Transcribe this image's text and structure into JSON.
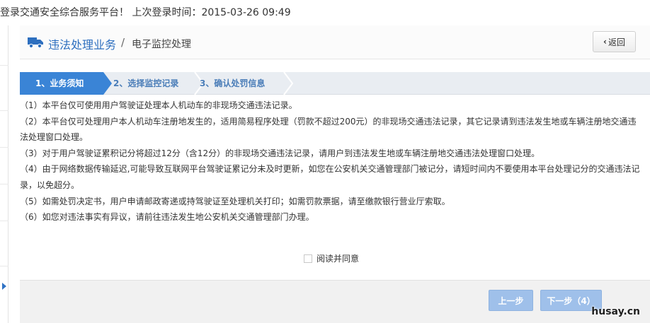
{
  "topbar": {
    "welcome": "登录交通安全综合服务平台！ 上次登录时间：2015-03-26 09:49"
  },
  "header": {
    "title": "违法处理业务",
    "separator": "/",
    "subtitle": "电子监控处理",
    "back_label": "返回"
  },
  "steps": [
    {
      "label": "1、业务须知",
      "state": "active"
    },
    {
      "label": "2、选择监控记录",
      "state": "pending"
    },
    {
      "label": "3、确认处罚信息",
      "state": "pending"
    }
  ],
  "notices": [
    "（1）本平台仅可使用用户驾驶证处理本人机动车的非现场交通违法记录。",
    "（2）本平台仅可处理用户本人机动车注册地发生的，适用简易程序处理（罚款不超过200元）的非现场交通违法记录，其它记录请到违法发生地或车辆注册地交通违",
    "法处理窗口处理。",
    "（3）对于用户驾驶证累积记分将超过12分（含12分）的非现场交通违法记录，请用户到违法发生地或车辆注册地交通违法处理窗口处理。",
    "（4）由于网络数据传输延迟,可能导致互联网平台驾驶证累记分未及时更新，如您在公安机关交通管理部门被记分，请短时间内不要使用本平台处理记分的交通违法记",
    "录，以免超分。",
    "（5）如需处罚决定书，用户申请邮政寄递或持驾驶证至处理机关打印；如需罚款票据，请至缴款银行营业厅索取。",
    "（6）如您对违法事实有异议，请前往违法发生地公安机关交通管理部门办理。"
  ],
  "agree": {
    "label": "阅读并同意",
    "checked": false
  },
  "footer": {
    "prev_label": "上一步",
    "next_label": "下一步（4）"
  },
  "watermark": "husay.cn",
  "colors": {
    "accent": "#3a84d6",
    "title_blue": "#2d6fbf",
    "button_disabled": "#9fc0ea"
  }
}
